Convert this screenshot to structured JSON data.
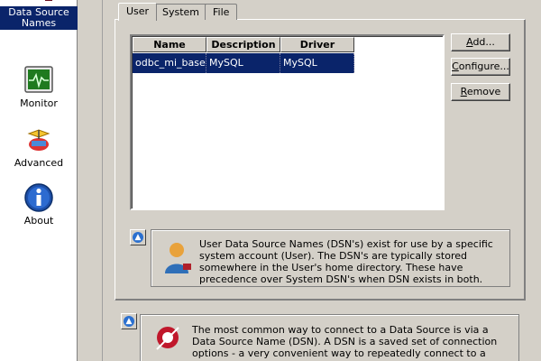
{
  "sidebar": {
    "items": [
      {
        "label": "Data Source Names",
        "icon": "dsn-plug-icon",
        "active": true
      },
      {
        "label": "Monitor",
        "icon": "monitor-icon",
        "active": false
      },
      {
        "label": "Advanced",
        "icon": "advanced-icon",
        "active": false
      },
      {
        "label": "About",
        "icon": "info-icon",
        "active": false
      }
    ]
  },
  "tabs": [
    "User",
    "System",
    "File"
  ],
  "list": {
    "columns": [
      "Name",
      "Description",
      "Driver"
    ],
    "rows": [
      {
        "name": "odbc_mi_base",
        "description": "MySQL",
        "driver": "MySQL"
      }
    ]
  },
  "buttons": {
    "add": {
      "mnemonic": "A",
      "rest": "dd..."
    },
    "configure": {
      "mnemonic": "C",
      "rest": "onfigure..."
    },
    "remove": {
      "mnemonic": "R",
      "rest": "emove"
    }
  },
  "info": {
    "user_dsn": "User Data Source Names (DSN's) exist for use by a specific system account (User). The DSN's are typically stored somewhere in the User's home directory. These have precedence over System DSN's when DSN exists in both.",
    "general": "The most common way to connect to a Data Source is via a Data Source Name (DSN). A DSN is a saved set of connection options - a very convenient way to repeatedly connect to a Data Source."
  },
  "colors": {
    "selection": "#0a246a",
    "face": "#d4d0c8"
  }
}
